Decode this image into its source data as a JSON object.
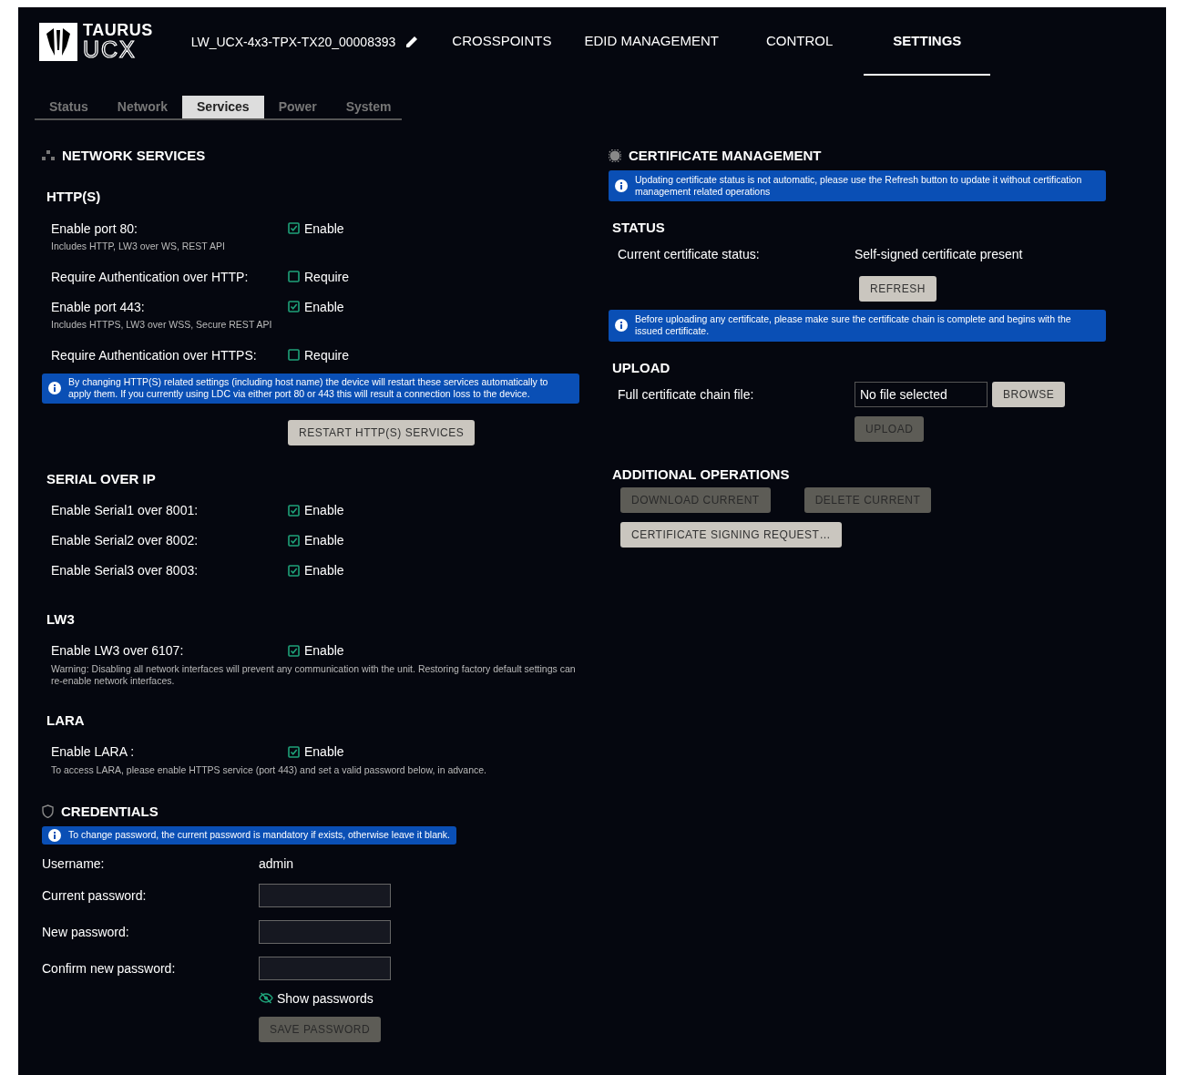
{
  "header": {
    "logo": {
      "line_1": "TAURUS",
      "line_2": "UCX"
    },
    "device_name": "LW_UCX-4x3-TPX-TX20_00008393",
    "nav": [
      {
        "label": "CROSSPOINTS",
        "selected": false
      },
      {
        "label": "EDID MANAGEMENT",
        "selected": false
      },
      {
        "label": "CONTROL",
        "selected": false
      },
      {
        "label": "SETTINGS",
        "selected": true
      }
    ]
  },
  "subtabs": [
    {
      "label": "Status",
      "selected": false
    },
    {
      "label": "Network",
      "selected": false
    },
    {
      "label": "Services",
      "selected": true
    },
    {
      "label": "Power",
      "selected": false
    },
    {
      "label": "System",
      "selected": false
    }
  ],
  "network_services": {
    "title": "NETWORK SERVICES",
    "groups": [
      {
        "title": "HTTP(S)",
        "items": [
          {
            "kind": "checkbox",
            "label": "Enable port 80:",
            "option": "Enable",
            "checked": true,
            "note": "Includes HTTP, LW3 over WS, REST API"
          },
          {
            "kind": "checkbox",
            "label": "Require Authentication over HTTP:",
            "option": "Require",
            "checked": false
          },
          {
            "kind": "checkbox",
            "label": "Enable port 443:",
            "option": "Enable",
            "checked": true,
            "note": "Includes HTTPS, LW3 over WSS, Secure REST API"
          },
          {
            "kind": "checkbox",
            "label": "Require Authentication over HTTPS:",
            "option": "Require",
            "checked": false
          },
          {
            "kind": "notice",
            "text": "By changing HTTP(S) related settings (including host name) the device will restart these services automatically to apply them. If you currently using LDC via either port 80 or 443 this will result a connection loss to the device."
          },
          {
            "kind": "button",
            "label": "RESTART HTTP(S) SERVICES",
            "disabled": false
          }
        ]
      },
      {
        "title": "SERIAL OVER IP",
        "items": [
          {
            "kind": "checkbox",
            "label": "Enable Serial1 over 8001:",
            "option": "Enable",
            "checked": true
          },
          {
            "kind": "checkbox",
            "label": "Enable Serial2 over 8002:",
            "option": "Enable",
            "checked": true
          },
          {
            "kind": "checkbox",
            "label": "Enable Serial3 over 8003:",
            "option": "Enable",
            "checked": true
          }
        ]
      },
      {
        "title": "LW3",
        "items": [
          {
            "kind": "checkbox",
            "label": "Enable LW3 over 6107:",
            "option": "Enable",
            "checked": true,
            "note": "Warning: Disabling all network interfaces will prevent any communication with the unit. Restoring factory default settings can re-enable network interfaces."
          }
        ]
      },
      {
        "title": "LARA",
        "items": [
          {
            "kind": "checkbox",
            "label": "Enable LARA :",
            "option": "Enable",
            "checked": true,
            "note": "To access LARA, please enable HTTPS service (port 443) and set a valid password below, in advance."
          }
        ]
      }
    ]
  },
  "credentials": {
    "title": "CREDENTIALS",
    "notice": "To change password, the current password is mandatory if exists, otherwise leave it blank.",
    "username": {
      "label": "Username:",
      "value": "admin"
    },
    "fields": [
      {
        "label": "Current password:"
      },
      {
        "label": "New password:"
      },
      {
        "label": "Confirm new password:"
      }
    ],
    "show_passwords": {
      "label": "Show passwords",
      "on": false
    },
    "save_button": {
      "label": "SAVE PASSWORD",
      "disabled": true
    }
  },
  "certificate_management": {
    "title": "CERTIFICATE MANAGEMENT",
    "notice": "Updating certificate status is not automatic, please use the Refresh button to update it without certification management related operations",
    "status": {
      "title": "STATUS",
      "label": "Current certificate status:",
      "value": "Self-signed certificate present",
      "button": {
        "label": "REFRESH",
        "disabled": false
      }
    },
    "upload_notice": "Before uploading any certificate, please make sure the certificate chain is complete and begins with the issued certificate.",
    "upload": {
      "title": "UPLOAD",
      "label": "Full certificate chain file:",
      "file_value": "No file selected",
      "browse_button": {
        "label": "BROWSE",
        "disabled": false
      },
      "upload_button": {
        "label": "UPLOAD",
        "disabled": true
      }
    },
    "additional": {
      "title": "ADDITIONAL OPERATIONS",
      "buttons": [
        {
          "label": "DOWNLOAD CURRENT",
          "disabled": true
        },
        {
          "label": "DELETE CURRENT",
          "disabled": true
        },
        {
          "label": "CERTIFICATE SIGNING REQUEST…",
          "disabled": false
        }
      ]
    }
  }
}
